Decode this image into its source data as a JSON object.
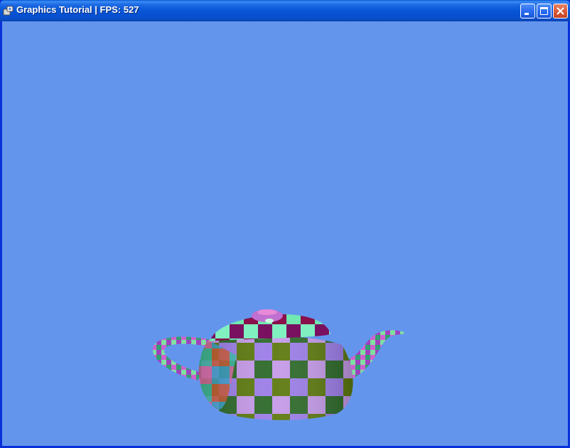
{
  "window": {
    "title": "Graphics Tutorial | FPS: 527",
    "icon": "app-icon",
    "controls": [
      "minimize",
      "maximize",
      "close"
    ]
  },
  "viewport": {
    "background_color": "#6495ed",
    "object": "teapot",
    "texture": "checkerboard"
  }
}
